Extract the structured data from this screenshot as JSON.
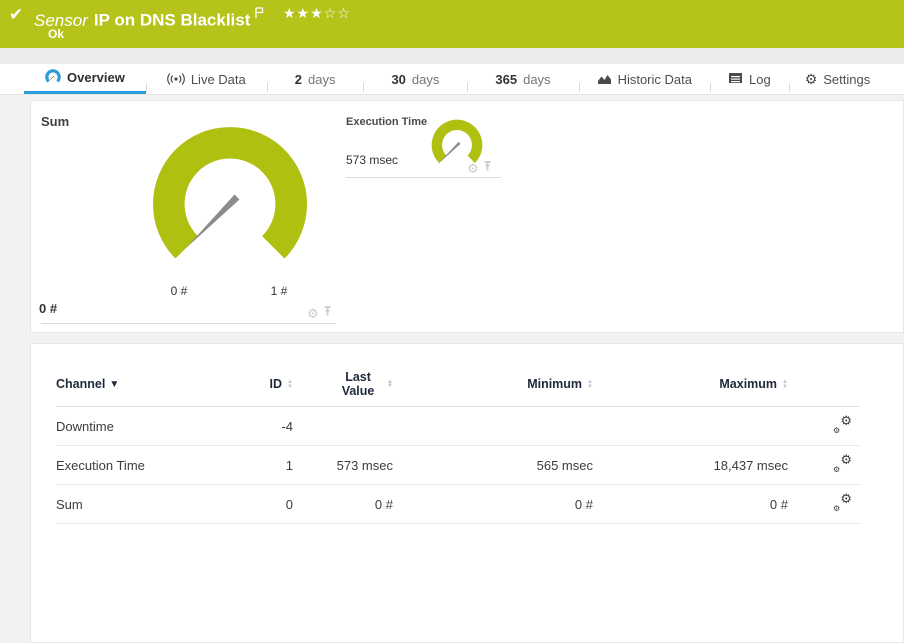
{
  "colors": {
    "brand_green": "#b5c31b",
    "gauge_green": "#b0c011",
    "accent_blue": "#2d9cdb",
    "needle_gray": "#8c8c8c"
  },
  "header": {
    "check_icon": "✔",
    "kind": "Sensor",
    "title": "IP on DNS Blacklist",
    "rating_filled": "★★★",
    "rating_empty": "☆☆",
    "status": "Ok"
  },
  "tabs": {
    "overview": {
      "label": "Overview"
    },
    "live_data": {
      "label": "Live Data"
    },
    "days2": {
      "num": "2",
      "label": "days"
    },
    "days30": {
      "num": "30",
      "label": "days"
    },
    "days365": {
      "num": "365",
      "label": "days"
    },
    "historic": {
      "label": "Historic Data"
    },
    "log": {
      "label": "Log"
    },
    "settings": {
      "label": "Settings"
    }
  },
  "gauges": {
    "sum": {
      "title": "Sum",
      "value": "0 #",
      "scale_min": "0 #",
      "scale_max": "1 #",
      "needle_angle_deg": 135
    },
    "execution_time": {
      "title": "Execution Time",
      "value": "573 msec",
      "needle_angle_deg": 135
    }
  },
  "table": {
    "headers": {
      "channel": "Channel",
      "id": "ID",
      "last_value": "Last Value",
      "minimum": "Minimum",
      "maximum": "Maximum"
    },
    "rows": [
      {
        "channel": "Downtime",
        "id": "-4",
        "last_value": "",
        "minimum": "",
        "maximum": ""
      },
      {
        "channel": "Execution Time",
        "id": "1",
        "last_value": "573 msec",
        "minimum": "565 msec",
        "maximum": "18,437 msec"
      },
      {
        "channel": "Sum",
        "id": "0",
        "last_value": "0 #",
        "minimum": "0 #",
        "maximum": "0 #"
      }
    ]
  }
}
